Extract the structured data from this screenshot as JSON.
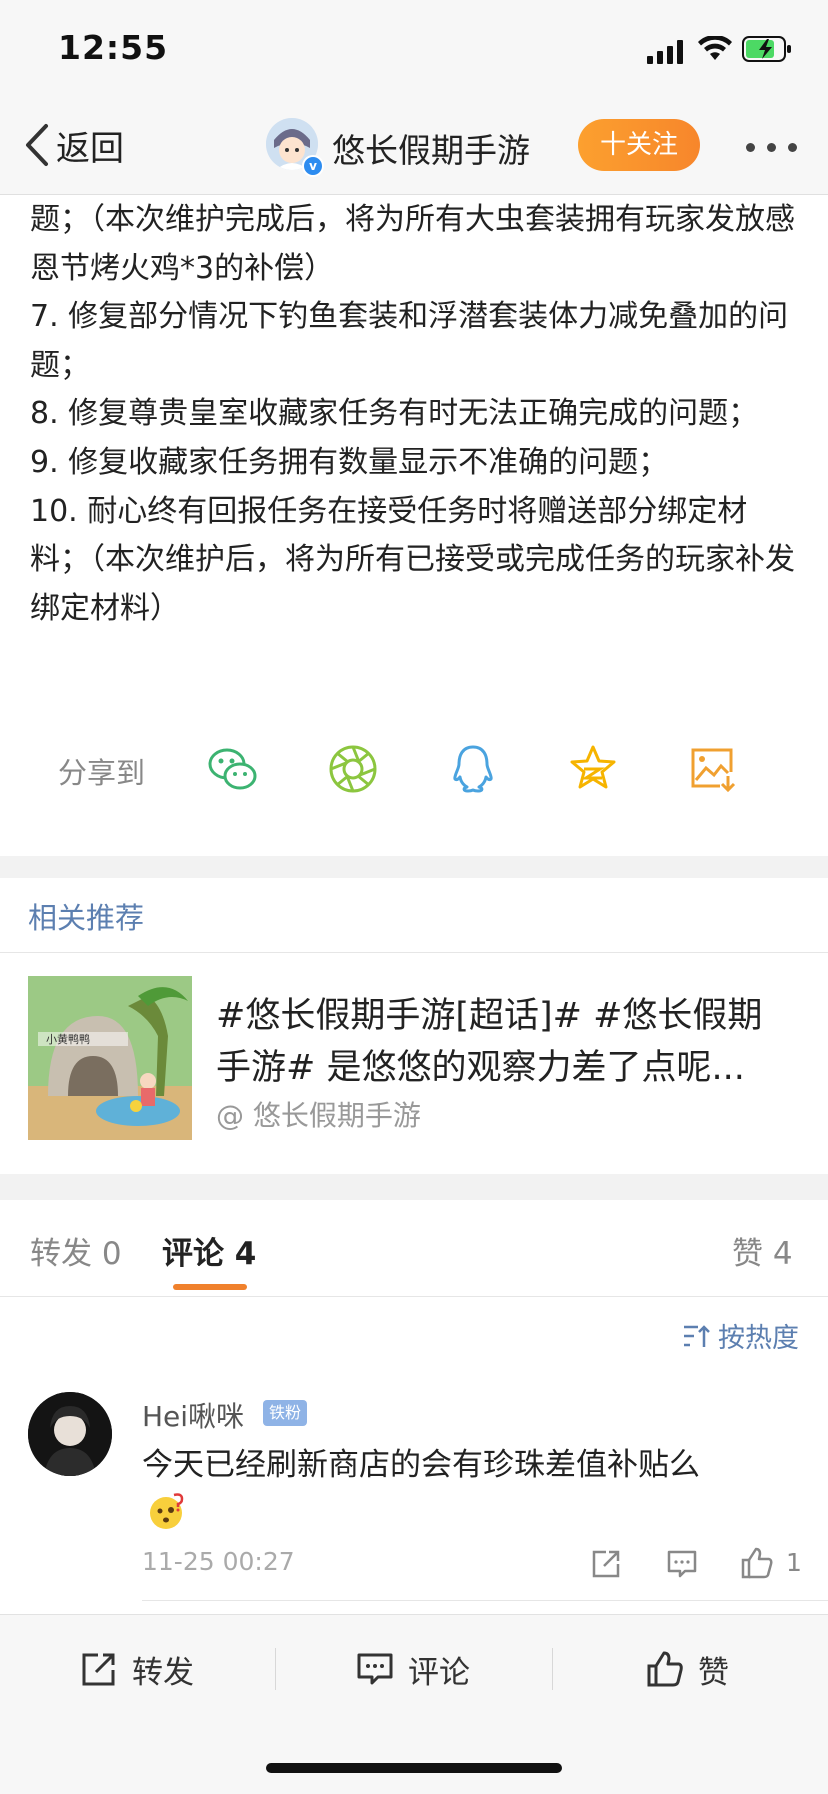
{
  "status_bar": {
    "time": "12:55"
  },
  "nav": {
    "back_label": "返回",
    "account_name": "悠长假期手游",
    "follow_label": "十关注"
  },
  "article": {
    "lines": [
      "题；（本次维护完成后，将为所有大虫套装拥有玩家发放感恩节烤火鸡*3的补偿）",
      "7. 修复部分情况下钓鱼套装和浮潜套装体力减免叠加的问题；",
      "8. 修复尊贵皇室收藏家任务有时无法正确完成的问题；",
      "9. 修复收藏家任务拥有数量显示不准确的问题；",
      "10. 耐心终有回报任务在接受任务时将赠送部分绑定材料；（本次维护后，将为所有已接受或完成任务的玩家补发绑定材料）"
    ]
  },
  "share": {
    "label": "分享到",
    "targets": [
      "wechat-icon",
      "moments-icon",
      "qq-icon",
      "qzone-icon",
      "save-image-icon"
    ]
  },
  "related": {
    "title": "相关推荐",
    "item": {
      "text": "#悠长假期手游[超话]# #悠长假期手游# 是悠悠的观察力差了点呢...",
      "author": "@ 悠长假期手游",
      "thumb_caption": "小黄鸭鸭"
    }
  },
  "tabs": {
    "repost": "转发 0",
    "comment": "评论 4",
    "like": "赞 4"
  },
  "sort_label": "按热度",
  "comment": {
    "user": "Hei啾咪",
    "badge": "铁粉",
    "text": "今天已经刷新商店的会有珍珠差值补贴么",
    "time": "11-25 00:27",
    "like_count": "1"
  },
  "bottom_bar": {
    "repost": "转发",
    "comment": "评论",
    "like": "赞"
  },
  "colors": {
    "accent_orange": "#f7862b",
    "link_blue": "#5c7fb0",
    "wechat": "#3cb371",
    "moments": "#8cc63f",
    "qq": "#4aa3df",
    "qzone": "#f6b400",
    "save": "#f0a030"
  }
}
